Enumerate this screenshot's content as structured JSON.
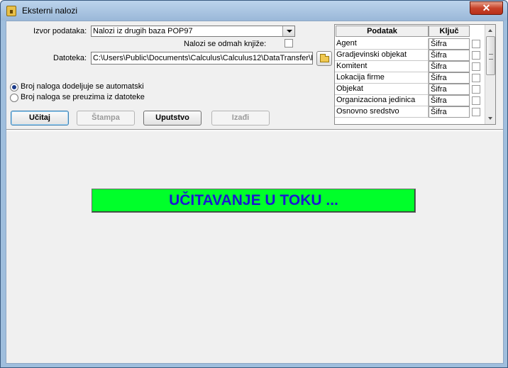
{
  "window": {
    "title": "Eksterni nalozi",
    "close_glyph": "✕"
  },
  "form": {
    "source_label": "Izvor podataka:",
    "source_value": "Nalozi iz drugih baza POP97",
    "post_immediately_label": "Nalozi se odmah knjiže:",
    "post_immediately_checked": false,
    "file_label": "Datoteka:",
    "file_value": "C:\\Users\\Public\\Documents\\Calculus\\Calculus12\\DataTransfer\\Ek",
    "radio_auto_label": "Broj naloga dodeljuje se automatski",
    "radio_file_label": "Broj naloga se preuzima iz datoteke",
    "radio_selected": "auto"
  },
  "buttons": {
    "load": "Učitaj",
    "print": "Štampa",
    "instructions": "Uputstvo",
    "exit": "Izađi"
  },
  "grid": {
    "columns": [
      "Podatak",
      "Ključ"
    ],
    "rows": [
      {
        "podatak": "Agent",
        "kljuc": "Šifra",
        "checked": false
      },
      {
        "podatak": "Gradjevinski objekat",
        "kljuc": "Šifra",
        "checked": false
      },
      {
        "podatak": "Komitent",
        "kljuc": "Šifra",
        "checked": false
      },
      {
        "podatak": "Lokacija firme",
        "kljuc": "Šifra",
        "checked": false
      },
      {
        "podatak": "Objekat",
        "kljuc": "Šifra",
        "checked": false
      },
      {
        "podatak": "Organizaciona jedinica",
        "kljuc": "Šifra",
        "checked": false
      },
      {
        "podatak": "Osnovno sredstvo",
        "kljuc": "Šifra",
        "checked": false
      }
    ]
  },
  "status": {
    "loading_text": "UČITAVANJE U TOKU ..."
  },
  "colors": {
    "banner_bg": "#00ff2a",
    "banner_text": "#1a1ad0",
    "close_button": "#c7432a"
  }
}
